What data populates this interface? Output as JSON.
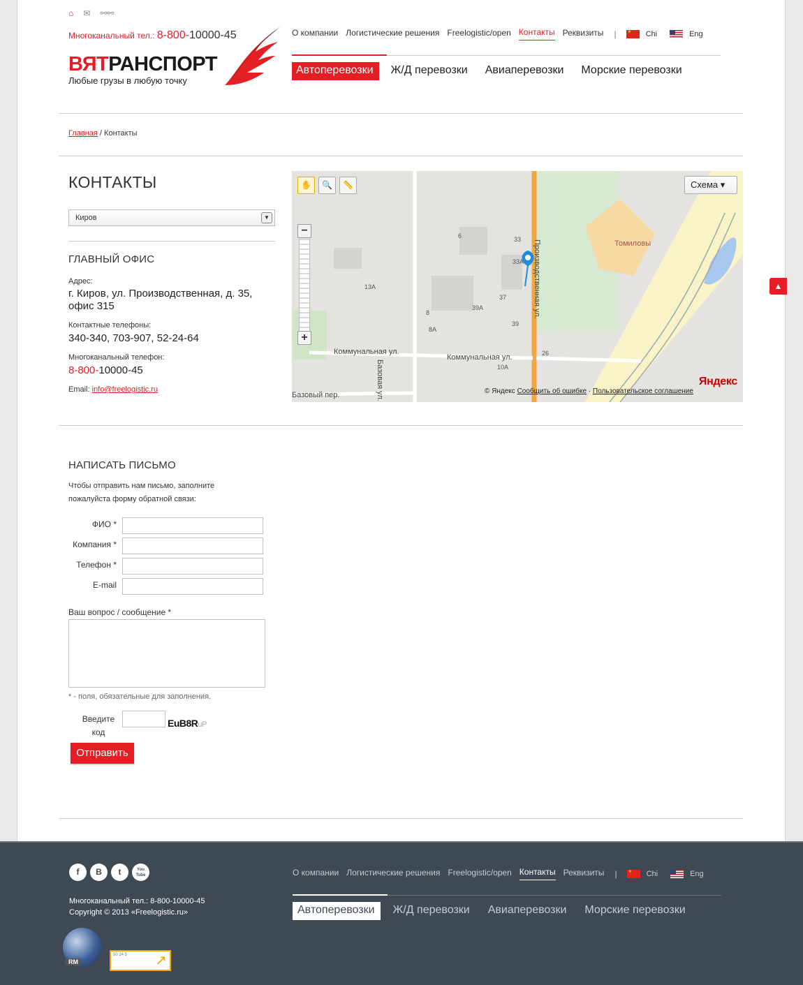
{
  "header": {
    "phone_label": "Многоканальный тел.:",
    "phone_code": "8-800-",
    "phone_number": "10000-45",
    "logo_red": "ВЯТ",
    "logo_black": "РАНСПОРТ",
    "tagline": "Любые грузы в любую точку"
  },
  "topnav": {
    "items": [
      "О компании",
      "Логистические решения",
      "Freelogistic/open",
      "Контакты",
      "Реквизиты"
    ],
    "separator": "|",
    "lang_chi": "Chi",
    "lang_eng": "Eng"
  },
  "mainnav": {
    "items": [
      "Автоперевозки",
      "Ж/Д перевозки",
      "Авиаперевозки",
      "Морские перевозки"
    ]
  },
  "breadcrumbs": {
    "home": "Главная",
    "sep": " / ",
    "current": "Контакты"
  },
  "contacts": {
    "title": "КОНТАКТЫ",
    "city_selected": "Киров",
    "office_title": "ГЛАВНЫЙ ОФИС",
    "address_label": "Адрес:",
    "address_value": "г. Киров, ул. Производственная, д. 35, офис 315",
    "phones_label": "Контактные телефоны:",
    "phones_value": "340-340, 703-907, 52-24-64",
    "multiphone_label": "Многоканальный телефон:",
    "multiphone_code": "8-800-",
    "multiphone_number": "10000-45",
    "email_label": "Email:",
    "email_value": "info@freelogistic.ru"
  },
  "map": {
    "mode_label": "Схема ▾",
    "copyright": "© Яндекс",
    "report_link": "Сообщить об ошибке",
    "terms_link": "Пользовательское соглашение",
    "brand": "Яндекс",
    "labels": {
      "tomilovy": "Томиловы",
      "kommunal_1": "Коммунальная ул.",
      "kommunal_2": "Коммунальная ул.",
      "bazovaya": "Базовая ул.",
      "bazovy_per": "Базовый пер.",
      "proizv": "Производственная ул.",
      "b33": "33",
      "b33a": "33А",
      "b6": "6",
      "b13a": "13А",
      "b37": "37",
      "b39a": "39А",
      "b8": "8",
      "b8a": "8А",
      "b39": "39",
      "b10a": "10А",
      "b26": "26"
    }
  },
  "form": {
    "title": "НАПИСАТЬ ПИСЬМО",
    "intro": "Чтобы отправить нам письмо, заполните пожалуйста форму обратной связи:",
    "fio": "ФИО *",
    "company": "Компания *",
    "phone": "Телефон *",
    "email": "E-mail",
    "message": "Ваш вопрос / сообщение *",
    "required_note": "* - поля, обязательные для заполнения.",
    "captcha_label": "Введите код",
    "captcha_text": "EuB8R",
    "captcha_faint": "uP",
    "submit": "Отправить"
  },
  "footer": {
    "social": [
      "f",
      "B",
      "t",
      "You Tube"
    ],
    "phone_line": "Многоканальный тел.: 8-800-10000-45",
    "copyright": "Copyright © 2013 «Freelogistic.ru»",
    "globe_tag": "RM",
    "counter_digits": "50 24 5"
  },
  "colors": {
    "accent": "#e31e24",
    "footer_bg": "#3f4953"
  }
}
